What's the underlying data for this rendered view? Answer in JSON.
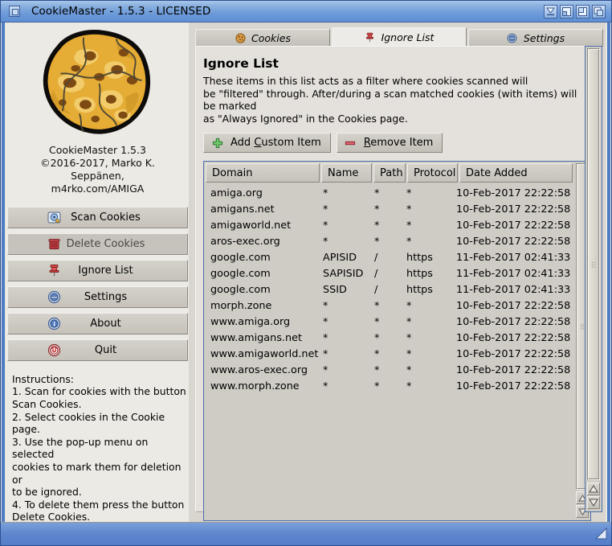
{
  "window": {
    "title": "CookieMaster - 1.5.3 - LICENSED",
    "gadgets": [
      {
        "name": "iconify-gadget",
        "glyph": "iconify"
      },
      {
        "name": "snapshot-gadget",
        "glyph": "snapshot"
      },
      {
        "name": "zoom-gadget",
        "glyph": "zoom"
      },
      {
        "name": "depth-gadget",
        "glyph": "depth"
      }
    ],
    "left_gadget": "window-close-gadget",
    "resize_grip": "resize-grip"
  },
  "sidebar": {
    "logo_alt": "cookie-logo",
    "credit": "CookieMaster 1.5.3\n©2016-2017, Marko K. Seppänen,\nm4rko.com/AMIGA",
    "buttons": [
      {
        "label": "Scan Cookies",
        "icon": "disk-scan-icon",
        "enabled": true
      },
      {
        "label": "Delete Cookies",
        "icon": "trash-icon",
        "enabled": false
      },
      {
        "label": "Ignore List",
        "icon": "pushpin-icon",
        "enabled": true
      },
      {
        "label": "Settings",
        "icon": "settings-icon",
        "enabled": true
      },
      {
        "label": "About",
        "icon": "info-icon",
        "enabled": true
      },
      {
        "label": "Quit",
        "icon": "power-icon",
        "enabled": true
      }
    ],
    "instructions": "Instructions:\n1. Scan for cookies with the button\nScan Cookies.\n2. Select cookies in the Cookie page.\n3. Use the pop-up menu on selected\ncookies to mark them for deletion or\nto be ignored.\n4. To delete them press the button\nDelete Cookies."
  },
  "tabs": [
    {
      "label": "Cookies",
      "icon": "cookie-icon",
      "active": false
    },
    {
      "label": "Ignore List",
      "icon": "pushpin-icon",
      "active": true
    },
    {
      "label": "Settings",
      "icon": "settings-icon",
      "active": false
    }
  ],
  "page": {
    "title": "Ignore List",
    "description": "These items in this list acts as a filter where cookies scanned will\nbe \"filtered\" through. After/during a scan matched cookies (with items) will be marked\nas \"Always Ignored\" in the Cookies page."
  },
  "actions": {
    "add": {
      "label_pre": "Add ",
      "accel": "C",
      "label_post": "ustom Item",
      "icon": "plus-icon",
      "icon_color": "#5cbf5c"
    },
    "remove": {
      "label_pre": "",
      "accel": "R",
      "label_post": "emove Item",
      "icon": "minus-icon",
      "icon_color": "#d4606e"
    }
  },
  "table": {
    "columns": [
      "Domain",
      "Name",
      "Path",
      "Protocol",
      "Date Added"
    ],
    "rows": [
      [
        "amiga.org",
        "*",
        "*",
        "*",
        "10-Feb-2017 22:22:58"
      ],
      [
        "amigans.net",
        "*",
        "*",
        "*",
        "10-Feb-2017 22:22:58"
      ],
      [
        "amigaworld.net",
        "*",
        "*",
        "*",
        "10-Feb-2017 22:22:58"
      ],
      [
        "aros-exec.org",
        "*",
        "*",
        "*",
        "10-Feb-2017 22:22:58"
      ],
      [
        "google.com",
        "APISID",
        "/",
        "https",
        "11-Feb-2017 02:41:33"
      ],
      [
        "google.com",
        "SAPISID",
        "/",
        "https",
        "11-Feb-2017 02:41:33"
      ],
      [
        "google.com",
        "SSID",
        "/",
        "https",
        "11-Feb-2017 02:41:33"
      ],
      [
        "morph.zone",
        "*",
        "*",
        "*",
        "10-Feb-2017 22:22:58"
      ],
      [
        "www.amiga.org",
        "*",
        "*",
        "*",
        "10-Feb-2017 22:22:58"
      ],
      [
        "www.amigans.net",
        "*",
        "*",
        "*",
        "10-Feb-2017 22:22:58"
      ],
      [
        "www.amigaworld.net",
        "*",
        "*",
        "*",
        "10-Feb-2017 22:22:58"
      ],
      [
        "www.aros-exec.org",
        "*",
        "*",
        "*",
        "10-Feb-2017 22:22:58"
      ],
      [
        "www.morph.zone",
        "*",
        "*",
        "*",
        "10-Feb-2017 22:22:58"
      ]
    ]
  },
  "colors": {
    "titlebar": "#6d9ad8",
    "accent_blue": "#4d7cc4",
    "panel": "#d9d6d0",
    "face": "#cfccc6",
    "cookie": "#e0a52d"
  }
}
